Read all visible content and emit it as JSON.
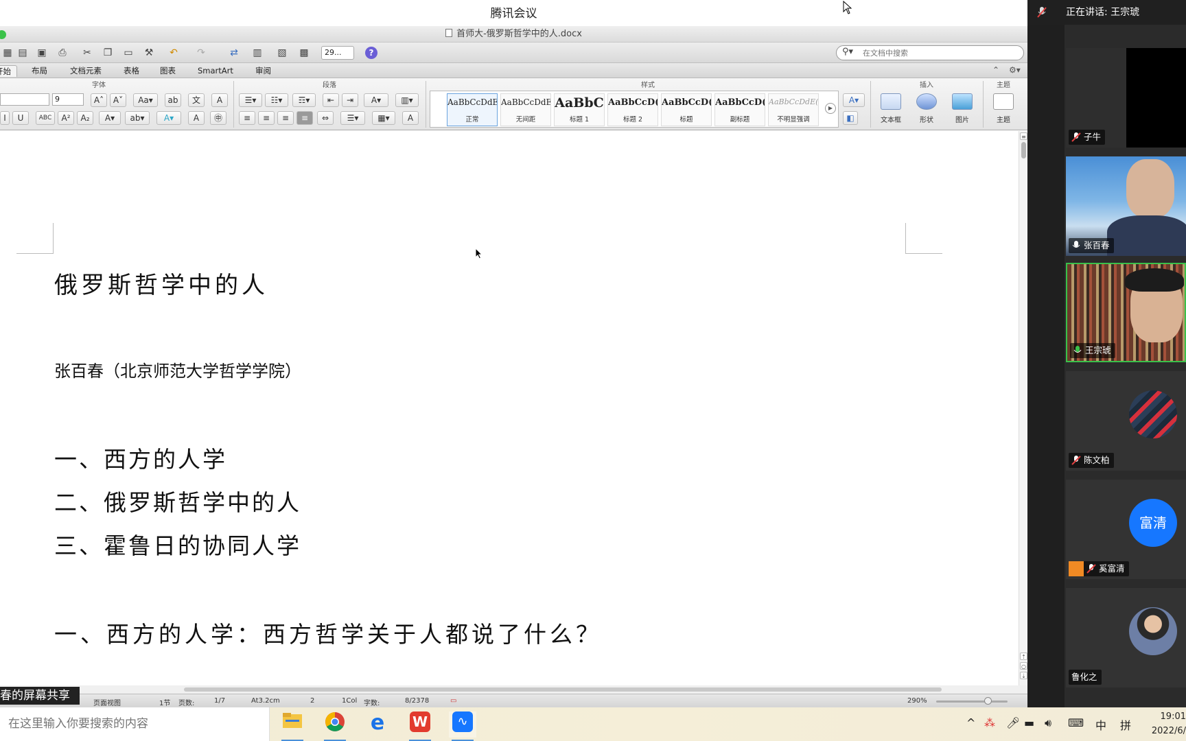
{
  "meeting": {
    "app_title": "腾讯会议",
    "speaking_label": "正在讲话: 王宗琥"
  },
  "word": {
    "doc_title": "首师大-俄罗斯哲学中的人.docx",
    "zoom_value": "29...",
    "search_placeholder": "在文档中搜索",
    "tabs": [
      "开始",
      "布局",
      "文档元素",
      "表格",
      "图表",
      "SmartArt",
      "审阅"
    ],
    "groups": {
      "font": "字体",
      "paragraph": "段落",
      "styles": "样式",
      "insert": "插入",
      "theme": "主题"
    },
    "font_size": "9",
    "styles": [
      {
        "preview": "AaBbCcDdE",
        "name": "正常"
      },
      {
        "preview": "AaBbCcDdE",
        "name": "无间距"
      },
      {
        "preview": "AaBbC",
        "name": "标题 1"
      },
      {
        "preview": "AaBbCcD(",
        "name": "标题 2"
      },
      {
        "preview": "AaBbCcD(",
        "name": "标题"
      },
      {
        "preview": "AaBbCcD(",
        "name": "副标题"
      },
      {
        "preview": "AaBbCcDdE(",
        "name": "不明显强调"
      }
    ],
    "insert_buttons": [
      "文本框",
      "形状",
      "图片"
    ],
    "theme_button": "主题"
  },
  "document": {
    "title": "俄罗斯哲学中的人",
    "author": "张百春（北京师范大学哲学学院）",
    "toc": [
      "一、西方的人学",
      "二、俄罗斯哲学中的人",
      "三、霍鲁日的协同人学"
    ],
    "section_heading": "一、西方的人学：西方哲学关于人都说了什么？"
  },
  "status": {
    "view": "页面视图",
    "section": "1节",
    "pages_label": "页数:",
    "pages": "1/7",
    "at": "At3.2cm",
    "line": "2",
    "col": "1Col",
    "words_label": "字数:",
    "words": "8/2378",
    "zoom": "290%",
    "share_label": "春的屏幕共享"
  },
  "participants": [
    {
      "name": "子牛",
      "muted": true,
      "kind": "video-dark"
    },
    {
      "name": "张百春",
      "muted": false,
      "kind": "video-sky"
    },
    {
      "name": "王宗琥",
      "muted": false,
      "kind": "video-books",
      "active": true
    },
    {
      "name": "陈文柏",
      "muted": true,
      "kind": "avatar-logo"
    },
    {
      "name": "奚富清",
      "muted": true,
      "kind": "avatar-text",
      "avatar_text": "富清"
    },
    {
      "name": "鲁化之",
      "muted": null,
      "kind": "avatar-photo"
    }
  ],
  "taskbar": {
    "search_placeholder": "在这里输入你要搜索的内容",
    "ime_lang": "中",
    "ime_mode": "拼",
    "time": "19:01",
    "date": "2022/6/"
  },
  "colors": {
    "active_border": "#3ac14a",
    "avatar_blue": "#1677ff",
    "link_blue": "#1677ff"
  }
}
